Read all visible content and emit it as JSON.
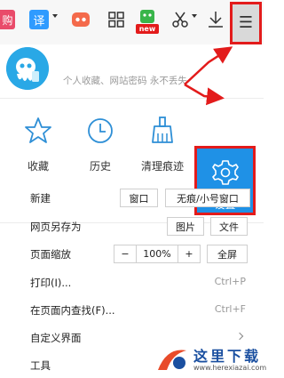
{
  "toolbar": {
    "items": [
      "snap-icon",
      "translate-icon",
      "game-icon",
      "apps-grid-icon",
      "new-app-icon",
      "scissors-icon",
      "download-icon"
    ],
    "partial_text": "购",
    "translate_label": "译",
    "new_badge": "new",
    "menu_glyph": "☰"
  },
  "user": {
    "subtitle": "个人收藏、网站密码 永不丢失"
  },
  "quick_actions": [
    {
      "label": "收藏",
      "icon": "star-icon"
    },
    {
      "label": "历史",
      "icon": "clock-icon"
    },
    {
      "label": "清理痕迹",
      "icon": "broom-icon"
    },
    {
      "label": "设置",
      "icon": "gear-icon"
    }
  ],
  "menu": {
    "new": {
      "label": "新建",
      "window": "窗口",
      "incognito": "无痕/小号窗口"
    },
    "save_as": {
      "label": "网页另存为",
      "image": "图片",
      "file": "文件"
    },
    "zoom": {
      "label": "页面缩放",
      "minus": "−",
      "value": "100%",
      "plus": "+",
      "fullscreen": "全屏"
    },
    "print": {
      "label": "打印(I)...",
      "shortcut": "Ctrl+P"
    },
    "find": {
      "label": "在页面内查找(F)...",
      "shortcut": "Ctrl+F"
    },
    "customize": {
      "label": "自定义界面"
    },
    "tools": {
      "label": "工具"
    }
  },
  "watermark": {
    "text": "这里下载",
    "url": "www.herexiazai.com"
  },
  "colors": {
    "accent": "#1f91e6",
    "highlight": "#e31b1b",
    "icon": "#2e8fd6"
  }
}
